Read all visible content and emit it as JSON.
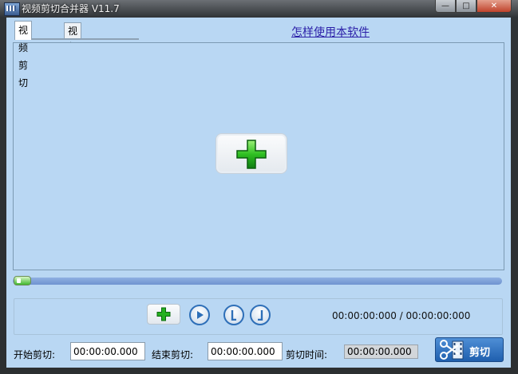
{
  "window": {
    "title": "视频剪切合并器 V11.7",
    "controls": {
      "minimize": "—",
      "maximize": "□",
      "close": "✕"
    }
  },
  "tabs": [
    {
      "label": "视频剪切",
      "active": true
    },
    {
      "label": "视频合并",
      "active": false
    }
  ],
  "help_link": "怎样使用本软件",
  "icons": {
    "add_video": "green-plus-icon",
    "add_small": "green-plus-icon",
    "play": "play-icon",
    "mark_start": "mark-start-icon",
    "mark_end": "mark-end-icon",
    "cut": "scissors-film-icon"
  },
  "playback": {
    "progress": 0.0,
    "time_display": "00:00:00:000 / 00:00:00:000"
  },
  "cut_form": {
    "start_label": "开始剪切:",
    "start_value": "00:00:00.000",
    "end_label": "结束剪切:",
    "end_value": "00:00:00.000",
    "duration_label": "剪切时间:",
    "duration_value": "00:00:00.000",
    "cut_button": "剪切"
  },
  "colors": {
    "background": "#b9d7f3",
    "accent_green": "#1fa020",
    "cut_button": "#2a6ec0",
    "link": "#2b1fa8"
  }
}
